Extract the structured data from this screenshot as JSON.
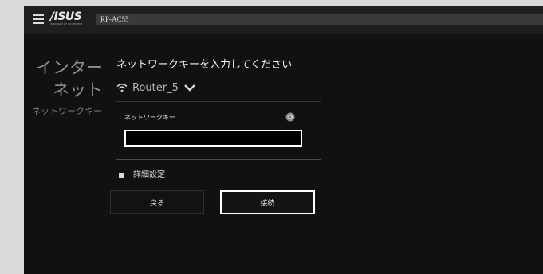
{
  "header": {
    "brand": "/ISUS",
    "brand_tagline": "IN SEARCH OF INCREDIBLE",
    "model": "RP-AC55"
  },
  "sidebar": {
    "title_line1": "インター",
    "title_line2": "ネット",
    "subtitle": "ネットワークキー"
  },
  "form": {
    "heading": "ネットワークキーを入力してください",
    "ssid": "Router_5",
    "key_label": "ネットワークキー",
    "key_value": "",
    "advanced_label": "詳細設定",
    "back_label": "戻る",
    "connect_label": "接続"
  },
  "icons": {
    "menu": "hamburger-icon",
    "wifi": "wifi-icon",
    "dropdown": "chevron-down-icon",
    "show_password": "eye-icon"
  },
  "colors": {
    "background": "#111111",
    "topbar": "#1e1e1e",
    "highlight_border": "#ffffff"
  }
}
